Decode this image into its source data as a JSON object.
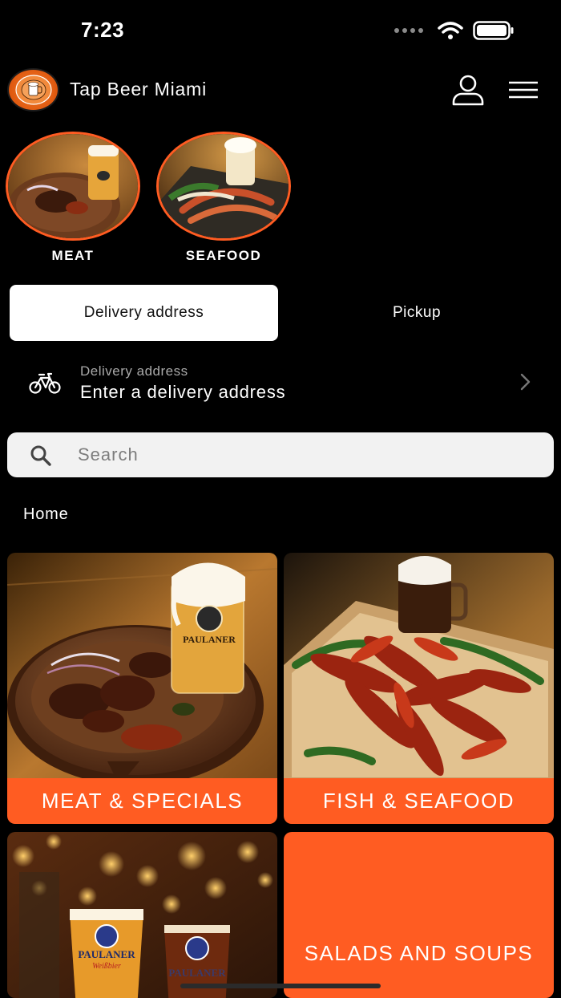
{
  "status_bar": {
    "time": "7:23"
  },
  "header": {
    "title": "Tap Beer Miami",
    "logo_text": "TAP BEER · NEW YORK & MIAMI"
  },
  "quick_categories": [
    {
      "label": "MEAT"
    },
    {
      "label": "SEAFOOD"
    }
  ],
  "order_mode": {
    "delivery_label": "Delivery address",
    "pickup_label": "Pickup",
    "selected": "Delivery address"
  },
  "address": {
    "label": "Delivery address",
    "value": "Enter a delivery address"
  },
  "search": {
    "placeholder": "Search",
    "value": ""
  },
  "breadcrumb": "Home",
  "menu_tiles": [
    {
      "label": "MEAT & SPECIALS"
    },
    {
      "label": "FISH & SEAFOOD"
    },
    {
      "label": ""
    },
    {
      "label": "SALADS AND SOUPS"
    }
  ],
  "colors": {
    "accent": "#ff5c22",
    "background": "#000000",
    "search_bg": "#f2f2f2"
  },
  "icons": [
    "user-icon",
    "hamburger-menu-icon",
    "bicycle-icon",
    "chevron-right-icon",
    "search-icon"
  ]
}
